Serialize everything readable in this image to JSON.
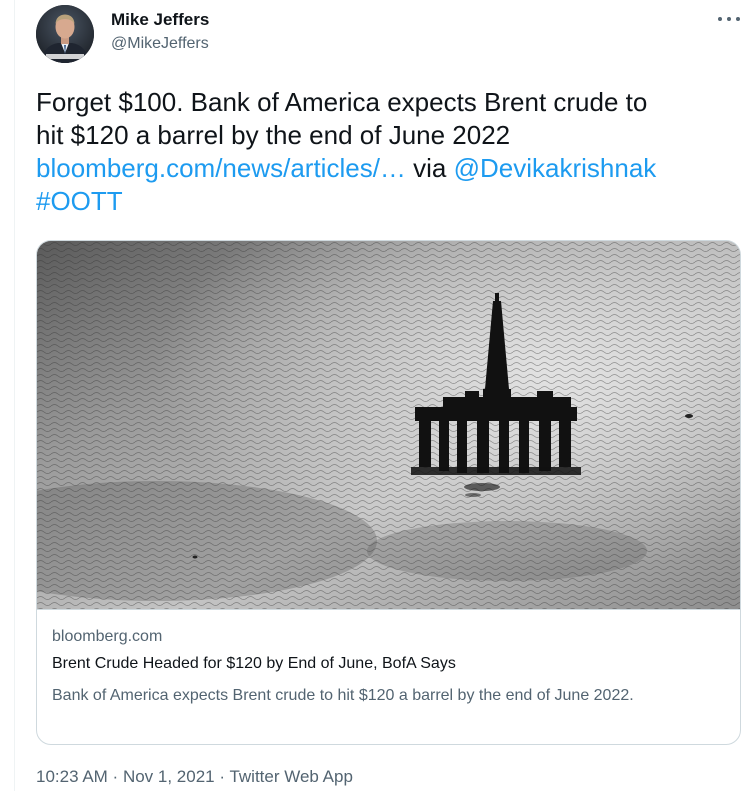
{
  "author": {
    "name": "Mike Jeffers",
    "handle": "@MikeJeffers"
  },
  "tweet": {
    "line1": "Forget $100.  Bank of America expects Brent crude to",
    "line2": "hit $120 a barrel by the end of June 2022",
    "link_text": "bloomberg.com/news/articles/…",
    "via_text": " via ",
    "mention": "@Devikakrishnak",
    "hashtag": "#OOTT"
  },
  "card": {
    "domain": "bloomberg.com",
    "title": "Brent Crude Headed for $120 by End of June, BofA Says",
    "description": "Bank of America expects Brent crude to hit $120 a barrel by the end of June 2022."
  },
  "meta": {
    "time": "10:23 AM",
    "sep1": " · ",
    "date": "Nov 1, 2021",
    "sep2": " · ",
    "source": "Twitter Web App"
  },
  "icons": {
    "more": "more-options-icon",
    "avatar": "avatar-photo"
  },
  "colors": {
    "link": "#1d9bf0",
    "secondary_text": "#536471",
    "primary_text": "#0f1419",
    "card_border": "#cfd9de"
  }
}
